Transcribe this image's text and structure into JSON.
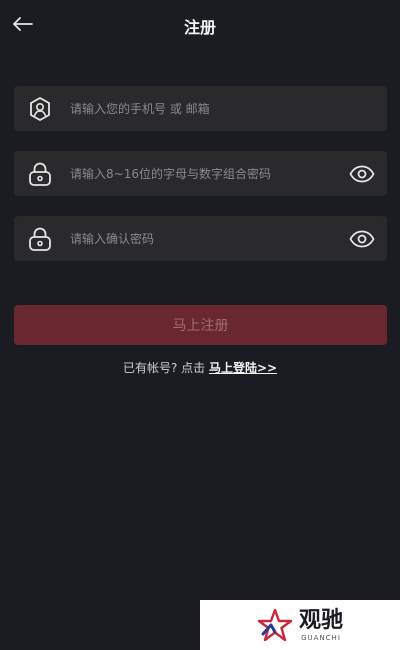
{
  "header": {
    "back_icon": "arrow-left-icon",
    "title": "注册"
  },
  "form": {
    "account": {
      "icon": "user-shield-icon",
      "placeholder": "请输入您的手机号 或 邮箱",
      "value": ""
    },
    "password": {
      "icon": "lock-icon",
      "placeholder": "请输入8~16位的字母与数字组合密码",
      "value": "",
      "toggle_icon": "eye-icon"
    },
    "confirm_password": {
      "icon": "lock-icon",
      "placeholder": "请输入确认密码",
      "value": "",
      "toggle_icon": "eye-icon"
    },
    "submit_label": "马上注册"
  },
  "login_prompt": {
    "text": "已有帐号? 点击 ",
    "link": "马上登陆>>"
  },
  "watermark": {
    "logo_text": "观驰",
    "logo_subtext": "GUANCHI",
    "icon": "star-logo-icon"
  },
  "colors": {
    "background": "#1b1c22",
    "field": "#2a2a2c",
    "button": "#6b2730",
    "button_text": "#9a6f74"
  }
}
